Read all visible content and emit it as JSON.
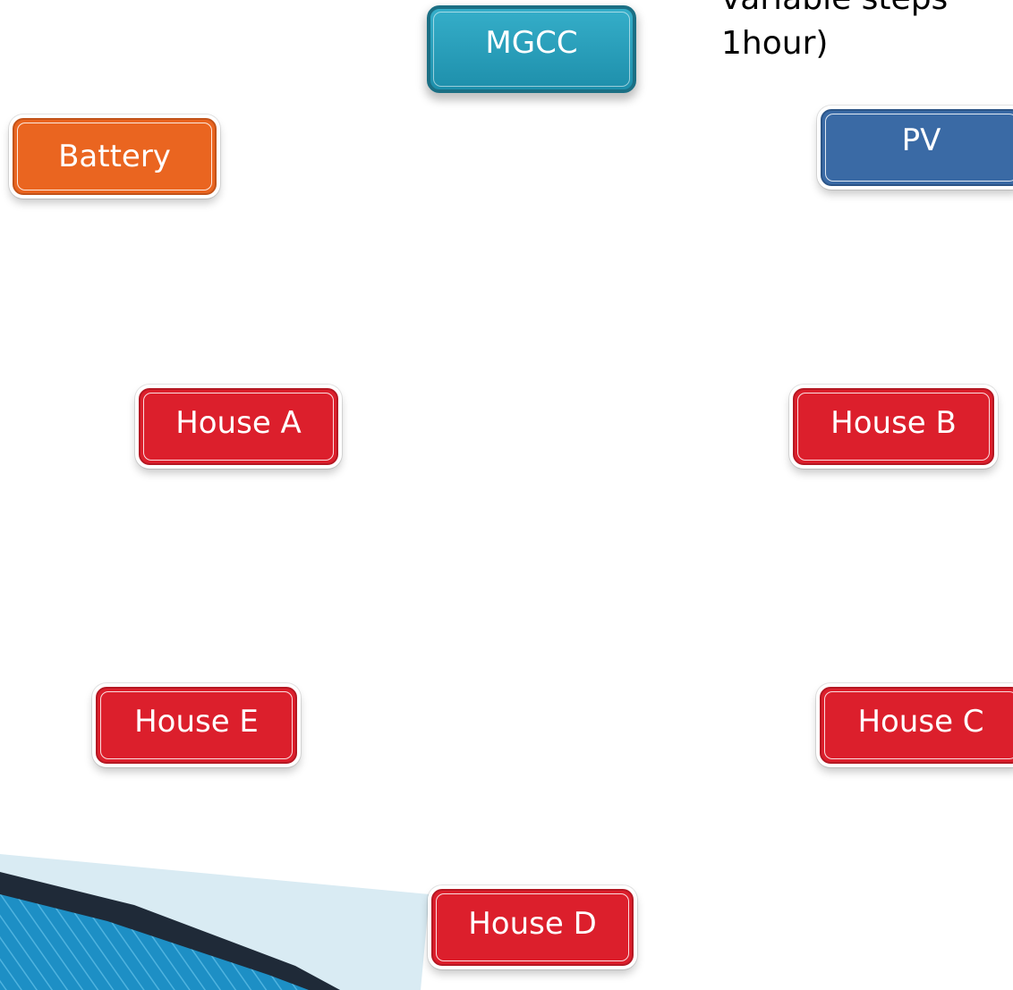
{
  "caption": {
    "line1": "variable steps",
    "line2": "1hour)"
  },
  "nodes": {
    "mgcc": "MGCC",
    "battery": "Battery",
    "pv": "PV",
    "house_a": "House A",
    "house_b": "House B",
    "house_c": "House C",
    "house_d": "House D",
    "house_e": "House E"
  },
  "colors": {
    "mgcc": "#2a9fbb",
    "battery": "#ea6520",
    "pv": "#3a6aa5",
    "house": "#dc1f2c",
    "decoration_light": "#d9ebf3",
    "decoration_dark": "#1f2a38",
    "decoration_blue": "#1d8fc5"
  }
}
